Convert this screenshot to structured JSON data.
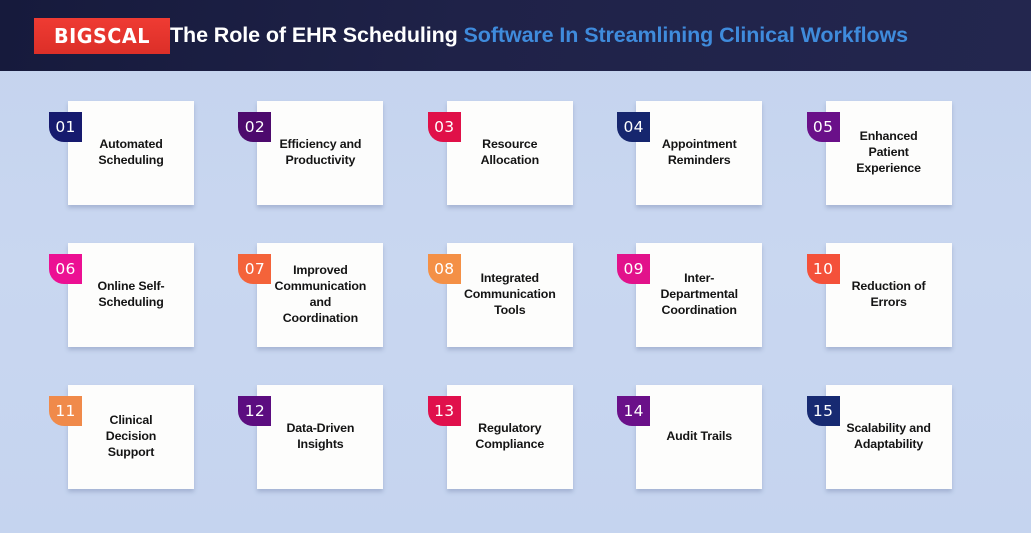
{
  "header": {
    "logo_text": "BIGSCAL",
    "title_part1": "The Role of EHR Scheduling ",
    "title_part2": "Software In Streamlining Clinical Workflows",
    "background_color": "#1d2045",
    "logo_background_color": "#e8352e",
    "title_color_primary": "#ffffff",
    "title_color_accent": "#3f8bdc"
  },
  "page": {
    "background_color": "#c6d5ef",
    "card_background_color": "#fdfdfc",
    "card_text_color": "#141414"
  },
  "cards": [
    {
      "number": "01",
      "label": "Automated\nScheduling",
      "badge_color": "#161a6e"
    },
    {
      "number": "02",
      "label": "Efficiency and\nProductivity",
      "badge_color": "#4d0a6d"
    },
    {
      "number": "03",
      "label": "Resource\nAllocation",
      "badge_color": "#e01048"
    },
    {
      "number": "04",
      "label": "Appointment\nReminders",
      "badge_color": "#16266e"
    },
    {
      "number": "05",
      "label": "Enhanced\nPatient\nExperience",
      "badge_color": "#6a1089"
    },
    {
      "number": "06",
      "label": "Online Self-\nScheduling",
      "badge_color": "#ec1093"
    },
    {
      "number": "07",
      "label": "Improved\nCommunication\nand\nCoordination",
      "badge_color": "#f4633a"
    },
    {
      "number": "08",
      "label": "Integrated\nCommunication\nTools",
      "badge_color": "#f49046"
    },
    {
      "number": "09",
      "label": "Inter-\nDepartmental\nCoordination",
      "badge_color": "#e2128b"
    },
    {
      "number": "10",
      "label": "Reduction of\nErrors",
      "badge_color": "#f4513a"
    },
    {
      "number": "11",
      "label": "Clinical\nDecision\nSupport",
      "badge_color": "#f08a4a"
    },
    {
      "number": "12",
      "label": "Data-Driven\nInsights",
      "badge_color": "#5c0d80"
    },
    {
      "number": "13",
      "label": "Regulatory\nCompliance",
      "badge_color": "#e0104c"
    },
    {
      "number": "14",
      "label": "Audit Trails",
      "badge_color": "#6a1089"
    },
    {
      "number": "15",
      "label": "Scalability and\nAdaptability",
      "badge_color": "#172a72"
    }
  ]
}
